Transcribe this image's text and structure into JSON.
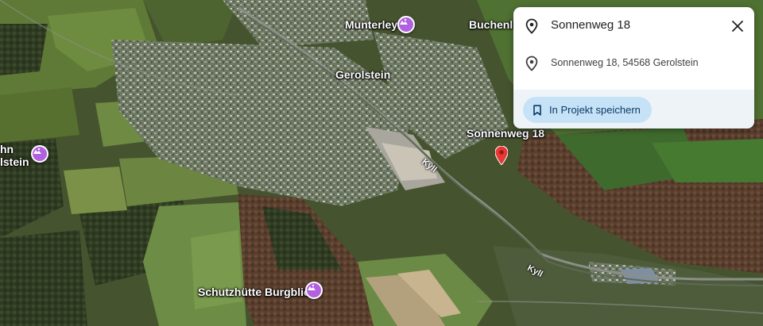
{
  "map": {
    "type": "satellite",
    "labels": {
      "munterley": "Munterley",
      "buchenloch": "Buchenloc",
      "gerolstein": "Gerolstein",
      "sonnenweg": "Sonnenweg 18",
      "left_edge_top": "hn",
      "left_edge_bottom": "lstein",
      "schutzhuette": "Schutzhütte Burgblick",
      "kyll_upper": "Kyll",
      "kyll_lower": "Kyll"
    },
    "poi_color": "#b161e0",
    "marker_color": "#e53935"
  },
  "card": {
    "title": "Sonnenweg 18",
    "address": "Sonnenweg 18, 54568 Gerolstein",
    "save_label": "In Projekt speichern",
    "close_icon": "close-icon",
    "pin_icon": "location-pin-icon",
    "bookmark_icon": "bookmark-icon",
    "accent": "#c6e2f7"
  }
}
